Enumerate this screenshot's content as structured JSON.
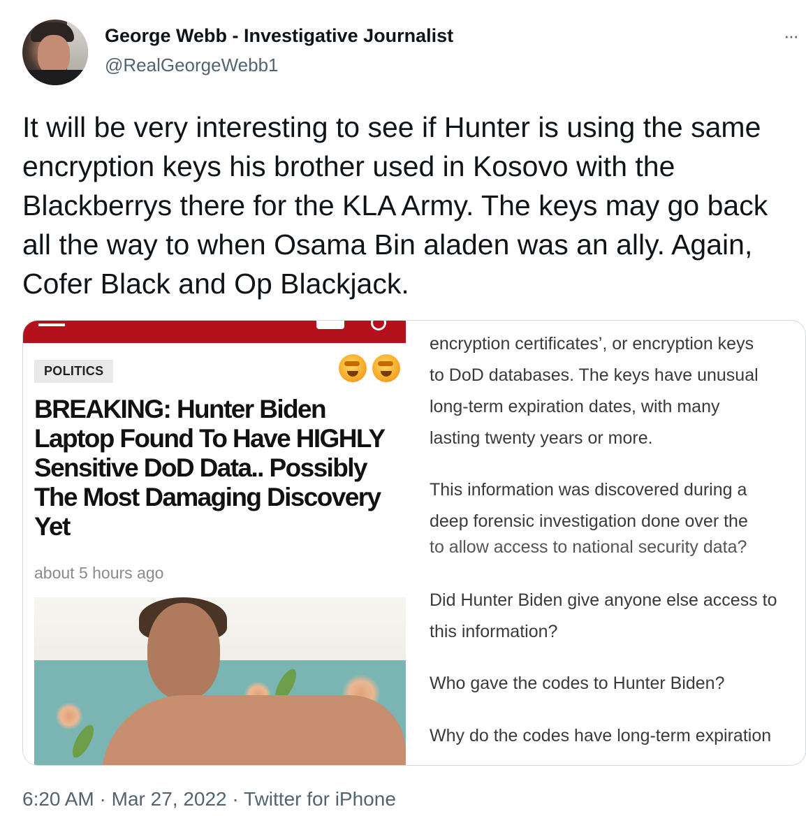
{
  "author": {
    "name": "George Webb - Investigative Journalist",
    "handle": "@RealGeorgeWebb1"
  },
  "more_icon": "···",
  "tweet": {
    "text": "It will be very interesting to see if Hunter is using the same encryption keys his brother used in Kosovo with the Blackberrys there for the KLA Army. The keys may go back all the way to when Osama Bin aladen was an ally. Again, Cofer Black and Op Blackjack."
  },
  "media": {
    "article": {
      "category": "POLITICS",
      "headline": "BREAKING: Hunter Biden Laptop Found To Have HIGHLY Sensitive DoD Data.. Possibly The Most Damaging Discovery Yet",
      "time": "about 5 hours ago"
    },
    "right_text": {
      "p1_lines": [
        "encryption certificates’, or encryption keys",
        "to DoD databases. The keys have unusual",
        "long-term expiration dates, with many",
        "lasting twenty years or more."
      ],
      "p2_lines": [
        "This information was discovered during a",
        "deep forensic investigation done over the"
      ],
      "cut_line": "to allow access to national security data?",
      "q1_lines": [
        "Did Hunter Biden give anyone else access to",
        "this information?"
      ],
      "q2": "Who gave the codes to Hunter Biden?",
      "q3": "Why do the codes have long-term expiration"
    }
  },
  "footer": {
    "time": "6:20 AM",
    "date": "Mar 27, 2022",
    "source": "Twitter for iPhone",
    "separator": "·"
  }
}
